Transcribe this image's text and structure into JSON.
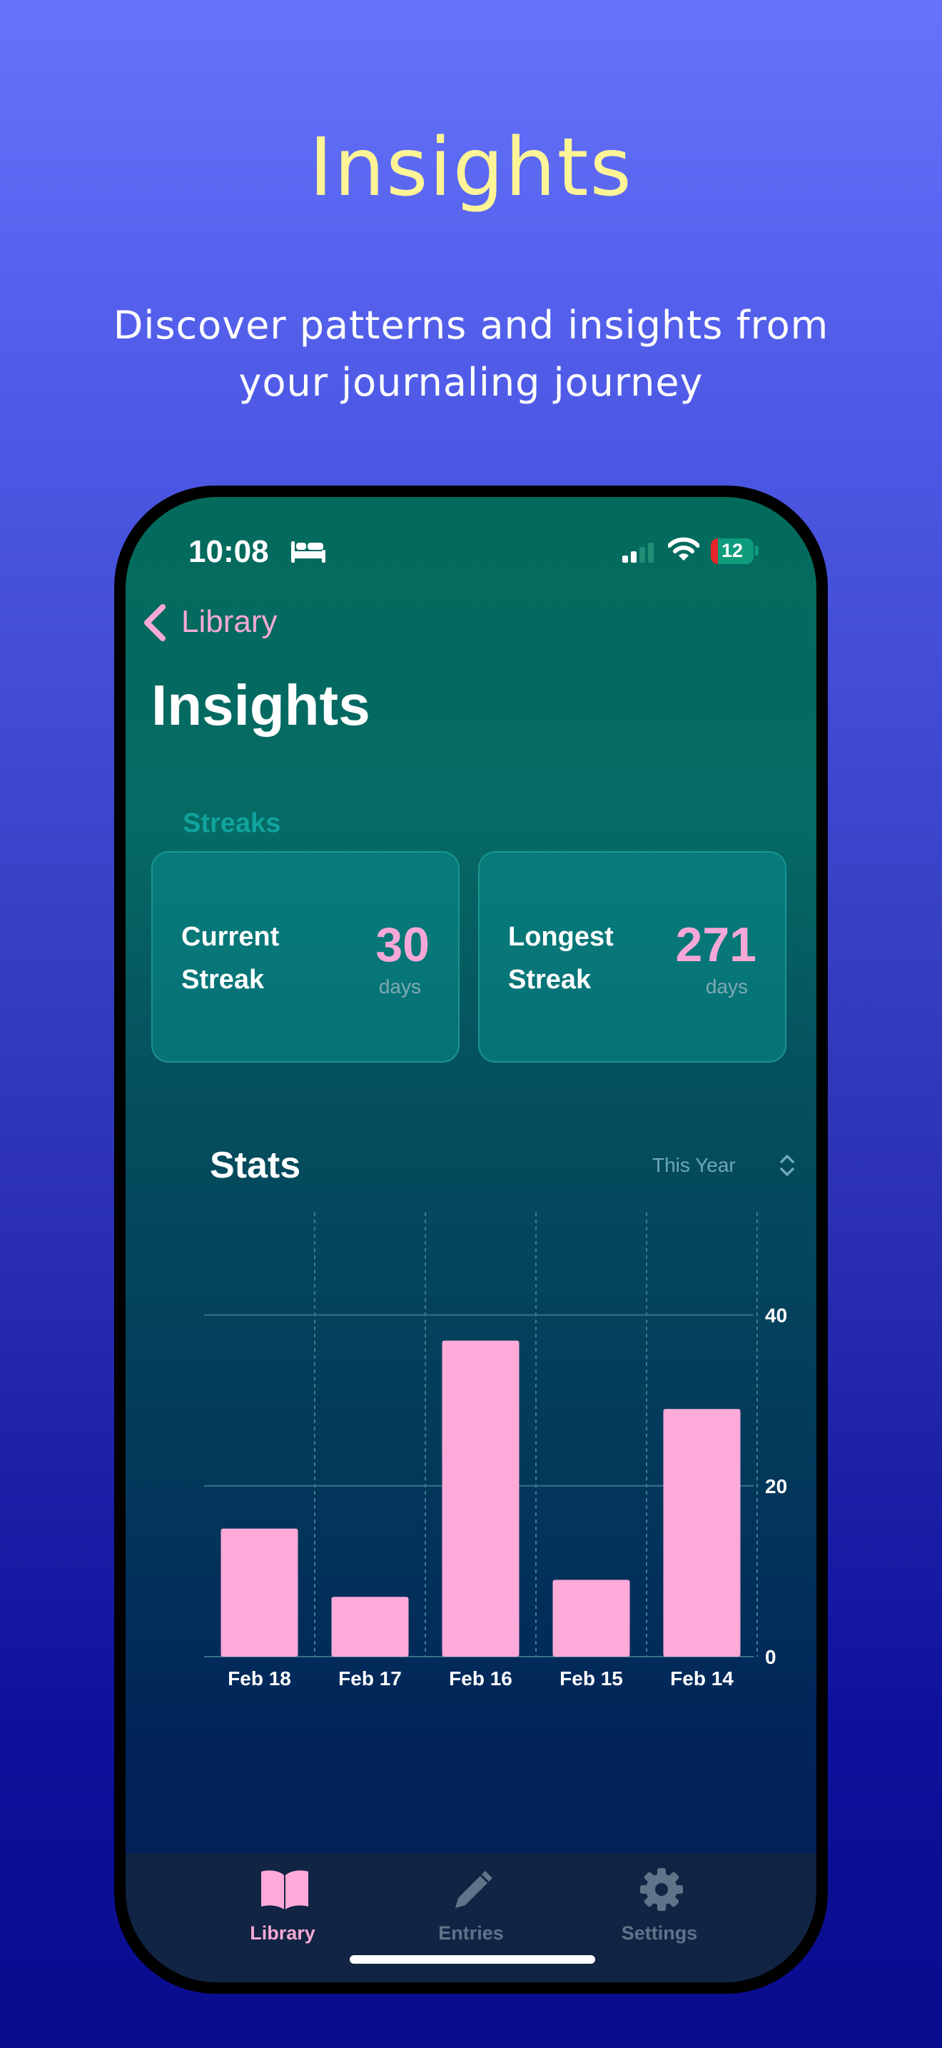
{
  "promo": {
    "title": "Insights",
    "subtitle": "Discover patterns and insights from your journaling journey"
  },
  "status_bar": {
    "time": "10:08",
    "battery": "12",
    "focus_icon": "bed-icon"
  },
  "nav": {
    "back_label": "Library"
  },
  "page": {
    "title": "Insights"
  },
  "streaks": {
    "section_label": "Streaks",
    "current": {
      "label": "Current Streak",
      "value": "30",
      "unit": "days"
    },
    "longest": {
      "label": "Longest Streak",
      "value": "271",
      "unit": "days"
    }
  },
  "stats": {
    "title": "Stats",
    "range": "This Year"
  },
  "chart_data": {
    "type": "bar",
    "categories": [
      "Feb 18",
      "Feb 17",
      "Feb 16",
      "Feb 15",
      "Feb 14"
    ],
    "values": [
      15,
      7,
      37,
      9,
      29
    ],
    "ylim": [
      0,
      52
    ],
    "yticks": [
      "0",
      "20",
      "40"
    ],
    "ytick_values": [
      0,
      20,
      40
    ],
    "grid": true,
    "bar_color": "#FFAAD9"
  },
  "tabs": [
    {
      "label": "Library",
      "icon": "book-icon",
      "active": true
    },
    {
      "label": "Entries",
      "icon": "pencil-icon",
      "active": false
    },
    {
      "label": "Settings",
      "icon": "gear-icon",
      "active": false
    }
  ],
  "colors": {
    "accent": "#F5A9D4",
    "title": "#FDF496",
    "streak_label": "#11A39E",
    "inactive_tab": "#5F7488"
  }
}
